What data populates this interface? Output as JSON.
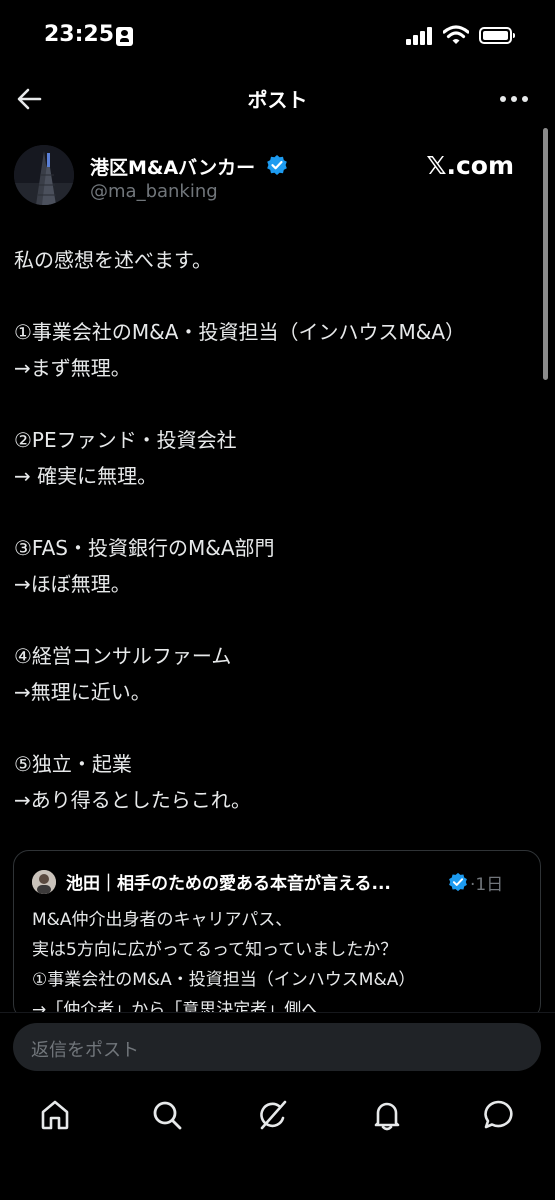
{
  "status_bar": {
    "time": "23:25"
  },
  "header": {
    "title": "ポスト"
  },
  "author": {
    "name": "港区M&Aバンカー",
    "handle": "@ma_banking",
    "watermark": "𝕏.com"
  },
  "post": {
    "lines": [
      "私の感想を述べます。",
      "①事業会社のM&A・投資担当（インハウスM&A）",
      "→まず無理。",
      "②PEファンド・投資会社",
      "→ 確実に無理。",
      "③FAS・投資銀行のM&A部門",
      "→ほぼ無理。",
      "④経営コンサルファーム",
      "→無理に近い。",
      "⑤独立・起業",
      "→あり得るとしたらこれ。"
    ]
  },
  "quote": {
    "name": "池田｜相手のための愛ある本音が言える...",
    "date": "·1日",
    "lines": [
      "M&A仲介出身者のキャリアパス、",
      "実は5方向に広がってるって知っていましたか？",
      "①事業会社のM&A・投資担当（インハウスM&A）",
      "→「仲介者」から「意思決定者」側へ"
    ]
  },
  "reply": {
    "placeholder": "返信をポスト"
  },
  "colors": {
    "background": "#000000",
    "verified": "#1d9bf0",
    "muted": "#71767b",
    "text": "#e7e9ea"
  },
  "icons": [
    "back-arrow-icon",
    "more-icon",
    "verified-icon",
    "home-icon",
    "search-icon",
    "grok-icon",
    "notifications-icon",
    "messages-icon"
  ]
}
